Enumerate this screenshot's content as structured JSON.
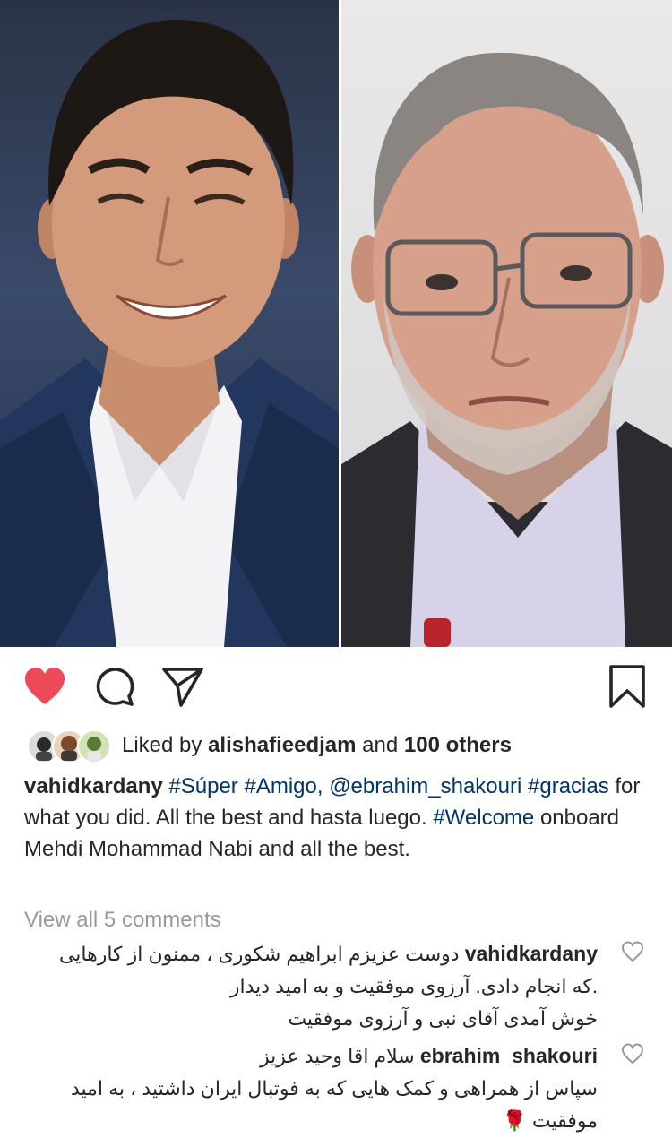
{
  "post": {
    "actions": {
      "like_icon": "heart-filled-icon",
      "comment_icon": "comment-bubble-icon",
      "share_icon": "paper-plane-icon",
      "save_icon": "bookmark-icon",
      "like_color": "#ed4956"
    },
    "likes": {
      "prefix": "Liked by",
      "user": "alishafieedjam",
      "middle": "and",
      "others": "100 others"
    },
    "caption": {
      "author": "vahidkardany",
      "tag1": "#Súper",
      "tag2": "#Amigo,",
      "mention": "@ebrahim_shakouri",
      "tag3": "#gracias",
      "text1": "for what you did. All the best and hasta luego.",
      "tag4": "#Welcome",
      "text2": "onboard Mehdi Mohammad Nabi and all the best."
    },
    "view_all": "View all 5 comments",
    "comments": [
      {
        "user": "vahidkardany",
        "line1": "دوست عزیزم ابراهیم شکوری ، ممنون از کارهایی",
        "line2": ".که انجام دادی. آرزوی موفقیت و به امید دیدار",
        "line3": "خوش آمدی آقای نبی و آرزوی موفقیت"
      },
      {
        "user": "ebrahim_shakouri",
        "line1": "سلام اقا وحید عزیز",
        "line2": "سپاس از همراهی و کمک هایی که به فوتبال ایران داشتید ، به امید",
        "line3": "موفقیت 🌹"
      }
    ]
  }
}
